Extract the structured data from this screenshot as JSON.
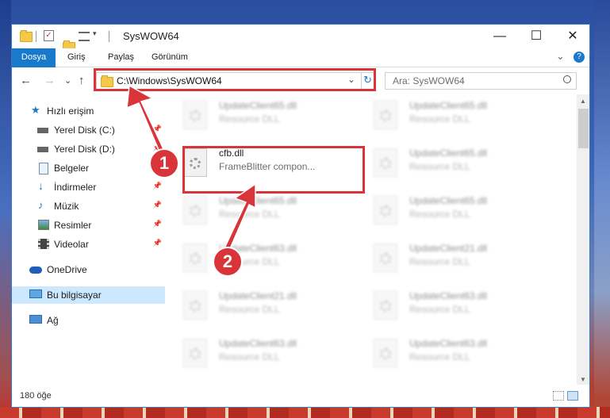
{
  "window": {
    "title": "SysWOW64",
    "controls": {
      "minimize": "—",
      "maximize": "☐",
      "close": "✕"
    }
  },
  "ribbon": {
    "tabs": [
      "Dosya",
      "Giriş",
      "Paylaş",
      "Görünüm"
    ],
    "expand": "⌄",
    "help": "?"
  },
  "address": {
    "path": "C:\\Windows\\SysWOW64",
    "dropdown": "⌄",
    "refresh": "↻"
  },
  "search": {
    "placeholder": "Ara: SysWOW64",
    "icon": "search-icon"
  },
  "nav": {
    "back": "←",
    "forward": "→",
    "recent": "⌄",
    "up": "↑"
  },
  "sidebar": {
    "items": [
      {
        "label": "Hızlı erişim",
        "icon": "star-icon"
      },
      {
        "label": "Yerel Disk (C:)",
        "icon": "drive-icon",
        "pinned": true
      },
      {
        "label": "Yerel Disk (D:)",
        "icon": "drive-icon",
        "pinned": true
      },
      {
        "label": "Belgeler",
        "icon": "documents-icon",
        "pinned": true
      },
      {
        "label": "İndirmeler",
        "icon": "download-icon",
        "pinned": true
      },
      {
        "label": "Müzik",
        "icon": "music-icon",
        "pinned": true
      },
      {
        "label": "Resimler",
        "icon": "pictures-icon",
        "pinned": true
      },
      {
        "label": "Videolar",
        "icon": "video-icon",
        "pinned": true
      },
      {
        "label": "OneDrive",
        "icon": "cloud-icon"
      },
      {
        "label": "Bu bilgisayar",
        "icon": "computer-icon",
        "selected": true
      },
      {
        "label": "Ağ",
        "icon": "network-icon"
      }
    ]
  },
  "files": {
    "highlighted": {
      "name": "cfb.dll",
      "description": "FrameBlitter compon..."
    },
    "left_column": [
      {
        "name": "UpdateClient65.dll",
        "description": "Resource DLL"
      },
      {
        "name": "UpdateClient65.dll",
        "description": "Resource DLL"
      },
      {
        "name": "UpdateClient63.dll",
        "description": "Resource DLL"
      },
      {
        "name": "UpdateClient21.dll",
        "description": "Resource DLL"
      },
      {
        "name": "UpdateClient63.dll",
        "description": "Resource DLL"
      }
    ],
    "right_column": [
      {
        "name": "UpdateClient65.dll",
        "description": "Resource DLL"
      },
      {
        "name": "UpdateClient65.dll",
        "description": "Resource DLL"
      },
      {
        "name": "UpdateClient65.dll",
        "description": "Resource DLL"
      },
      {
        "name": "UpdateClient21.dll",
        "description": "Resource DLL"
      },
      {
        "name": "UpdateClient63.dll",
        "description": "Resource DLL"
      },
      {
        "name": "UpdateClient63.dll",
        "description": "Resource DLL"
      }
    ]
  },
  "status": {
    "item_count": "180 öğe"
  },
  "annotations": {
    "step1": "1",
    "step2": "2",
    "color": "#d9343a"
  }
}
